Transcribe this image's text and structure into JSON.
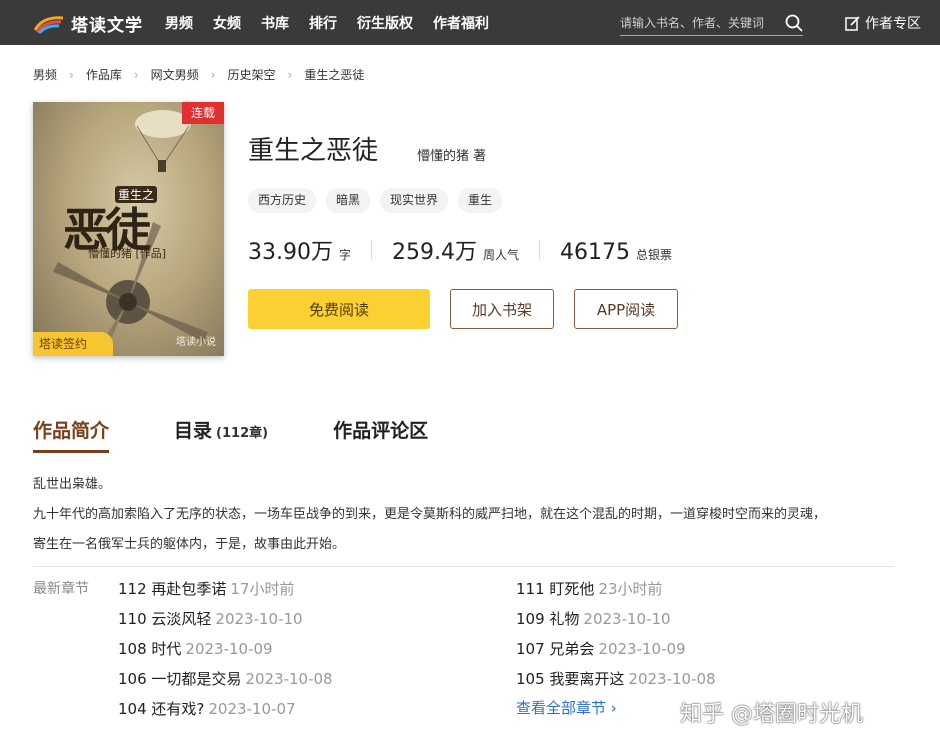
{
  "header": {
    "logo_text": "塔读文学",
    "nav": [
      "男频",
      "女频",
      "书库",
      "排行",
      "衍生版权",
      "作者福利"
    ],
    "search_placeholder": "请输入书名、作者、关键词",
    "author_zone": "作者专区"
  },
  "breadcrumb": [
    "男频",
    "作品库",
    "网文男频",
    "历史架空",
    "重生之恶徒"
  ],
  "cover": {
    "badge_serial": "连载",
    "badge_sign": "塔读签约",
    "title_small": "重生之",
    "title_big": "恶徒",
    "author_line": "懵懂的猪 [作品]",
    "brand": "塔读小说"
  },
  "book": {
    "title": "重生之恶徒",
    "author": "懵懂的猪 著",
    "tags": [
      "西方历史",
      "暗黑",
      "现实世界",
      "重生"
    ],
    "stats": [
      {
        "num": "33.90万",
        "unit": "字"
      },
      {
        "num": "259.4万",
        "unit": "周人气"
      },
      {
        "num": "46175",
        "unit": "总银票"
      }
    ],
    "btn_read": "免费阅读",
    "btn_shelf": "加入书架",
    "btn_app": "APP阅读"
  },
  "tabs": {
    "intro": "作品简介",
    "catalog": "目录",
    "catalog_count": "(112章)",
    "comments": "作品评论区"
  },
  "intro": [
    "乱世出枭雄。",
    "九十年代的高加索陷入了无序的状态，一场车臣战争的到来，更是令莫斯科的威严扫地，就在这个混乱的时期，一道穿梭时空而来的灵魂，",
    "寄生在一名俄军士兵的躯体内，于是，故事由此开始。"
  ],
  "latest": {
    "label": "最新章节",
    "chapters": [
      {
        "title": "112 再赴包季诺",
        "date": "17小时前"
      },
      {
        "title": "111 盯死他",
        "date": "23小时前"
      },
      {
        "title": "110 云淡风轻",
        "date": "2023-10-10"
      },
      {
        "title": "109 礼物",
        "date": "2023-10-10"
      },
      {
        "title": "108 时代",
        "date": "2023-10-09"
      },
      {
        "title": "107 兄弟会",
        "date": "2023-10-09"
      },
      {
        "title": "106 一切都是交易",
        "date": "2023-10-08"
      },
      {
        "title": "105 我要离开这",
        "date": "2023-10-08"
      },
      {
        "title": "104 还有戏?",
        "date": "2023-10-07"
      }
    ],
    "view_all": "查看全部章节 ›"
  },
  "watermark": "知乎 @塔圈时光机",
  "colors": {
    "topbar": "#3a3a3a",
    "accent_brown": "#7a3f1a",
    "read_button": "#fcd033",
    "serial_badge": "#e0302f",
    "link": "#2a6fd6"
  }
}
